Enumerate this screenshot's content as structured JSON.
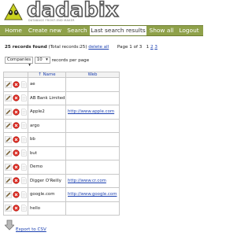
{
  "brand": {
    "name": "dadabix",
    "tagline": "DATABASE FRONT-END MAKER"
  },
  "nav": [
    {
      "label": "Home",
      "name": "nav-home"
    },
    {
      "label": "Create new",
      "name": "nav-create-new"
    },
    {
      "label": "Search",
      "name": "nav-search"
    },
    {
      "label": "Last search results",
      "name": "nav-last-search-results"
    },
    {
      "label": "Show all",
      "name": "nav-show-all"
    },
    {
      "label": "Logout",
      "name": "nav-logout"
    }
  ],
  "summary": {
    "count_label": "25 records found",
    "total_label": "(Total records:25)",
    "delete_all": "delete all",
    "page_label": "Page 1 of 3",
    "pages": [
      "1",
      "2",
      "3"
    ]
  },
  "controls": {
    "table_select": "Companies",
    "per_page_select": "10",
    "per_page_suffix": "records per page"
  },
  "table": {
    "columns": [
      "↑ Name",
      "Web"
    ],
    "rows": [
      {
        "name": "ae",
        "web": ""
      },
      {
        "name": "AB Bank Limited",
        "web": ""
      },
      {
        "name": "Apple2",
        "web": "http://www.apple.com"
      },
      {
        "name": "argo",
        "web": ""
      },
      {
        "name": "bb",
        "web": ""
      },
      {
        "name": "but",
        "web": ""
      },
      {
        "name": "Demo",
        "web": ""
      },
      {
        "name": "Digger O'Reilly",
        "web": "http://www.cr.com"
      },
      {
        "name": "google.com",
        "web": "http://www.google.com"
      },
      {
        "name": "hello",
        "web": ""
      }
    ]
  },
  "export": {
    "label": "Export to CSV"
  },
  "colors": {
    "nav_bg": "#8fa14a",
    "link": "#1a3fb0",
    "delete_red": "#d9241b"
  },
  "icons": {
    "edit": "pencil-icon",
    "delete": "delete-icon",
    "details": "details-icon",
    "export": "download-arrow-icon"
  }
}
